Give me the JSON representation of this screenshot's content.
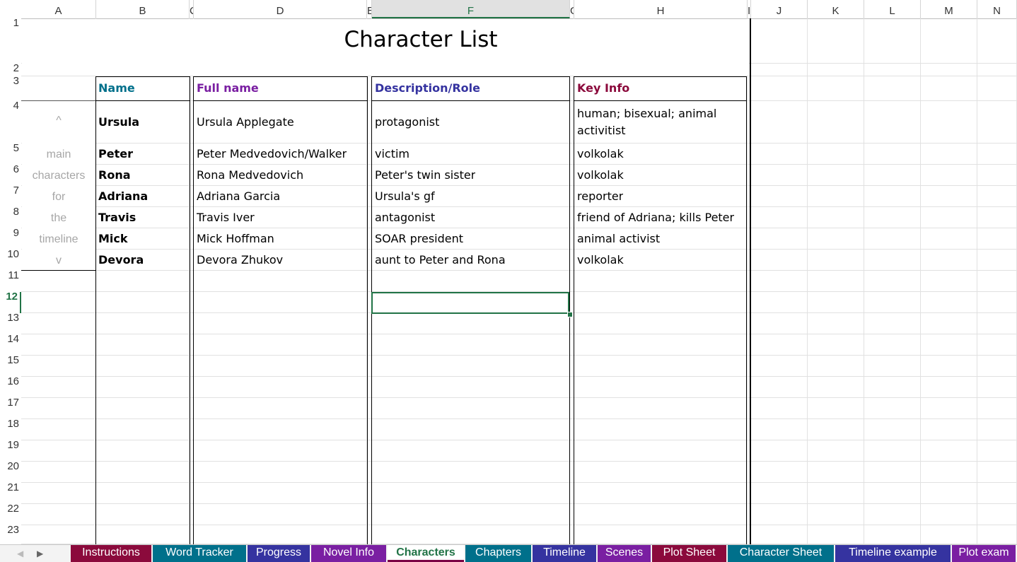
{
  "columns": [
    "A",
    "B",
    "C",
    "D",
    "E",
    "F",
    "G",
    "H",
    "I",
    "J",
    "K",
    "L",
    "M",
    "N"
  ],
  "rows": [
    "1",
    "2",
    "3",
    "4",
    "5",
    "6",
    "7",
    "8",
    "9",
    "10",
    "11",
    "12",
    "13",
    "14",
    "15",
    "16",
    "17",
    "18",
    "19",
    "20",
    "21",
    "22",
    "23"
  ],
  "title": "Character List",
  "headers": {
    "name": "Name",
    "full_name": "Full name",
    "description": "Description/Role",
    "key_info": "Key Info"
  },
  "header_colors": {
    "name": "#00708b",
    "full_name": "#7a1fa2",
    "description": "#3533a0",
    "key_info": "#8b0a3c"
  },
  "side_note": [
    "^",
    "main",
    "characters",
    "for",
    "the",
    "timeline",
    "v"
  ],
  "characters": [
    {
      "name": "Ursula",
      "full_name": "Ursula Applegate",
      "description": "protagonist",
      "key_info_1": "human; bisexual; animal",
      "key_info_2": "activitist"
    },
    {
      "name": "Peter",
      "full_name": "Peter Medvedovich/Walker",
      "description": "victim",
      "key_info_1": "volkolak",
      "key_info_2": ""
    },
    {
      "name": "Rona",
      "full_name": "Rona Medvedovich",
      "description": "Peter's twin sister",
      "key_info_1": "volkolak",
      "key_info_2": ""
    },
    {
      "name": "Adriana",
      "full_name": "Adriana Garcia",
      "description": "Ursula's gf",
      "key_info_1": "reporter",
      "key_info_2": ""
    },
    {
      "name": "Travis",
      "full_name": "Travis Iver",
      "description": "antagonist",
      "key_info_1": "friend of Adriana; kills Peter",
      "key_info_2": ""
    },
    {
      "name": "Mick",
      "full_name": "Mick Hoffman",
      "description": "SOAR president",
      "key_info_1": "animal activist",
      "key_info_2": ""
    },
    {
      "name": "Devora",
      "full_name": "Devora Zhukov",
      "description": "aunt to Peter and Rona",
      "key_info_1": "volkolak",
      "key_info_2": ""
    }
  ],
  "tabs": [
    {
      "label": "Instructions",
      "color": "#8b0a3c"
    },
    {
      "label": "Word Tracker",
      "color": "#00708b"
    },
    {
      "label": "Progress",
      "color": "#3533a0"
    },
    {
      "label": "Novel Info",
      "color": "#7a1fa2"
    },
    {
      "label": "Characters",
      "color": "#ffffff",
      "active": true
    },
    {
      "label": "Chapters",
      "color": "#00708b"
    },
    {
      "label": "Timeline",
      "color": "#3533a0"
    },
    {
      "label": "Scenes",
      "color": "#7a1fa2"
    },
    {
      "label": "Plot Sheet",
      "color": "#8b0a3c"
    },
    {
      "label": "Character Sheet",
      "color": "#00708b"
    },
    {
      "label": "Timeline example",
      "color": "#3533a0"
    },
    {
      "label": "Plot exam",
      "color": "#7a1fa2"
    }
  ],
  "selected_column": "F",
  "selected_row": "12"
}
